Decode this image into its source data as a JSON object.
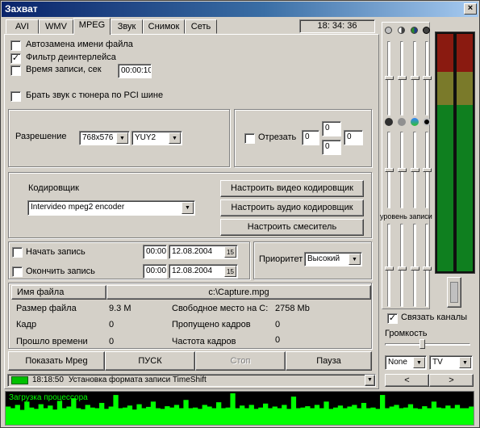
{
  "window": {
    "title": "Захват",
    "close_icon": "×"
  },
  "tabs": [
    {
      "label": "AVI"
    },
    {
      "label": "WMV"
    },
    {
      "label": "MPEG"
    },
    {
      "label": "Звук"
    },
    {
      "label": "Снимок"
    },
    {
      "label": "Сеть"
    }
  ],
  "active_tab": "MPEG",
  "clock": "18: 34: 36",
  "options": {
    "auto_rename_label": "Автозамена имени файла",
    "auto_rename_checked": false,
    "deinterlace_label": "Фильтр деинтерлейса",
    "deinterlace_checked": true,
    "record_time_label": "Время записи, сек",
    "record_time_checked": false,
    "record_time_value": "00:00:10",
    "pci_audio_label": "Брать звук с тюнера по PCI шине",
    "pci_audio_checked": false
  },
  "resolution": {
    "label": "Разрешение",
    "size_value": "768x576",
    "format_value": "YUY2"
  },
  "crop": {
    "label": "Отрезать",
    "checked": false,
    "left": "0",
    "top": "0",
    "right": "0",
    "bottom": "0"
  },
  "encoder": {
    "label": "Кодировщик",
    "value": "Intervideo mpeg2 encoder",
    "video_button": "Настроить видео кодировщик",
    "audio_button": "Настроить аудио кодировщик",
    "mixer_button": "Настроить смеситель"
  },
  "schedule": {
    "start_label": "Начать запись",
    "start_checked": false,
    "start_time": "00:00",
    "start_date": "12.08.2004",
    "end_label": "Окончить запись",
    "end_checked": false,
    "end_time": "00:00",
    "end_date": "12.08.2004",
    "calendar_label": "15"
  },
  "priority": {
    "label": "Приоритет",
    "value": "Высокий"
  },
  "file_info": {
    "filename_label": "Имя файла",
    "filename_value": "c:\\Capture.mpg",
    "size_label": "Размер файла",
    "size_value": "9.3 M",
    "free_space_label": "Свободное место на C:",
    "free_space_value": "2758 Mb",
    "frame_label": "Кадр",
    "frame_value": "0",
    "dropped_label": "Пропущено кадров",
    "dropped_value": "0",
    "elapsed_label": "Прошло времени",
    "elapsed_value": "0",
    "framerate_label": "Частота кадров",
    "framerate_value": "0"
  },
  "actions": {
    "show_mpeg": "Показать Mpeg",
    "start": "ПУСК",
    "stop": "Стоп",
    "pause": "Пауза"
  },
  "status": {
    "time": "18:18:50",
    "message": "Установка формата записи TimeShift",
    "cpu_label": "Загрузка процессора"
  },
  "right_panel": {
    "record_level_label": "уровень записи",
    "link_channels_label": "Связать каналы",
    "link_channels_checked": true,
    "volume_label": "Громкость",
    "channel_mode_value": "None",
    "source_value": "TV",
    "prev_icon": "<",
    "next_icon": ">"
  },
  "colors": {
    "titlebar_start": "#0a246a",
    "titlebar_end": "#a6caf0",
    "face": "#d4d0c8",
    "meter_green": "#0f7f1f",
    "meter_olive": "#7a7a2a",
    "meter_red": "#8a1a10",
    "cpu_graph": "#00ff00",
    "status_indicator": "#00c000"
  },
  "cpu_graph_levels": [
    0.55,
    0.5,
    0.6,
    0.45,
    0.7,
    0.52,
    0.48,
    0.62,
    0.5,
    0.58,
    0.46,
    0.72,
    0.5,
    0.55,
    0.8,
    0.5,
    0.47,
    0.6,
    0.52,
    0.5,
    0.66,
    0.48,
    0.55,
    0.9,
    0.5,
    0.52,
    0.58,
    0.46,
    0.62,
    0.5,
    0.54,
    0.7,
    0.5,
    0.48,
    0.56,
    0.52,
    0.6,
    0.5,
    0.75,
    0.5,
    0.52,
    0.48,
    0.6,
    0.55,
    0.5,
    0.68,
    0.5,
    0.52,
    0.95,
    0.5,
    0.58,
    0.5,
    0.6,
    0.48,
    0.52,
    0.64,
    0.5,
    0.55,
    0.5,
    0.6,
    0.48,
    0.85,
    0.5,
    0.52,
    0.56,
    0.5,
    0.6,
    0.5,
    0.7,
    0.48,
    0.52,
    0.58,
    0.5,
    0.55,
    0.6,
    0.5,
    0.66,
    0.5,
    0.52,
    0.48,
    0.9,
    0.5,
    0.55,
    0.6,
    0.5,
    0.52,
    0.62,
    0.5,
    0.48,
    0.56,
    0.5,
    0.7,
    0.52,
    0.5,
    0.58,
    0.5,
    0.6,
    0.5,
    0.5,
    0.55
  ]
}
